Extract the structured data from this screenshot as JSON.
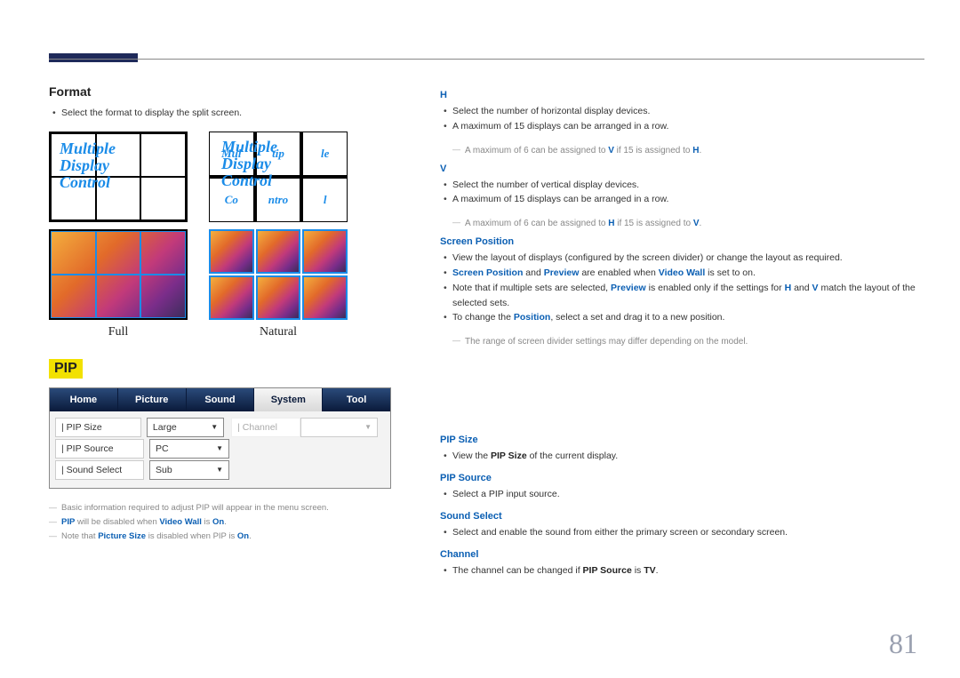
{
  "page_number": "81",
  "left": {
    "format_heading": "Format",
    "format_desc": "Select the format to display the split screen.",
    "mdc_text": "Multiple\nDisplay\nControl",
    "full_label": "Full",
    "natural_label": "Natural",
    "pip_badge": "PIP",
    "tabs": {
      "home": "Home",
      "picture": "Picture",
      "sound": "Sound",
      "system": "System",
      "tool": "Tool"
    },
    "rows": {
      "pip_size_label": "| PIP Size",
      "pip_size_value": "Large",
      "channel_label": "| Channel",
      "pip_source_label": "| PIP Source",
      "pip_source_value": "PC",
      "sound_select_label": "| Sound Select",
      "sound_select_value": "Sub"
    },
    "footnotes": {
      "n1": "Basic information required to adjust PIP will appear in the menu screen.",
      "n2_a": "PIP",
      "n2_b": " will be disabled when ",
      "n2_c": "Video Wall",
      "n2_d": " is ",
      "n2_e": "On",
      "n2_f": ".",
      "n3_a": "Note that ",
      "n3_b": "Picture Size",
      "n3_c": " is disabled when PIP is ",
      "n3_d": "On",
      "n3_e": "."
    }
  },
  "right": {
    "h": {
      "head": "H",
      "b1": "Select the number of horizontal display devices.",
      "b2": "A maximum of 15 displays can be arranged in a row.",
      "note_a": "A maximum of 6 can be assigned to ",
      "note_b": "V",
      "note_c": " if 15 is assigned to ",
      "note_d": "H",
      "note_e": "."
    },
    "v": {
      "head": "V",
      "b1": "Select the number of vertical display devices.",
      "b2": "A maximum of 15 displays can be arranged in a row.",
      "note_a": "A maximum of 6 can be assigned to ",
      "note_b": "H",
      "note_c": " if 15 is assigned to ",
      "note_d": "V",
      "note_e": "."
    },
    "sp": {
      "head": "Screen Position",
      "b1": "View the layout of displays (configured by the screen divider) or change the layout as required.",
      "b2_a": "Screen Position",
      "b2_b": " and ",
      "b2_c": "Preview",
      "b2_d": " are enabled when ",
      "b2_e": "Video Wall",
      "b2_f": " is set to on.",
      "b3_a": "Note that if multiple sets are selected, ",
      "b3_b": "Preview",
      "b3_c": " is enabled only if the settings for ",
      "b3_d": "H",
      "b3_e": " and ",
      "b3_f": "V",
      "b3_g": " match the layout of the selected sets.",
      "b4_a": "To change the ",
      "b4_b": "Position",
      "b4_c": ", select a set and drag it to a new position.",
      "note": "The range of screen divider settings may differ depending on the model."
    },
    "pip_size": {
      "head": "PIP Size",
      "b1_a": "View the ",
      "b1_b": "PIP Size",
      "b1_c": " of the current display."
    },
    "pip_source": {
      "head": "PIP Source",
      "b1": "Select a PIP input source."
    },
    "sound_select": {
      "head": "Sound Select",
      "b1": "Select and enable the sound from either the primary screen or secondary screen."
    },
    "channel": {
      "head": "Channel",
      "b1_a": "The channel can be changed if ",
      "b1_b": "PIP Source",
      "b1_c": " is ",
      "b1_d": "TV",
      "b1_e": "."
    }
  }
}
